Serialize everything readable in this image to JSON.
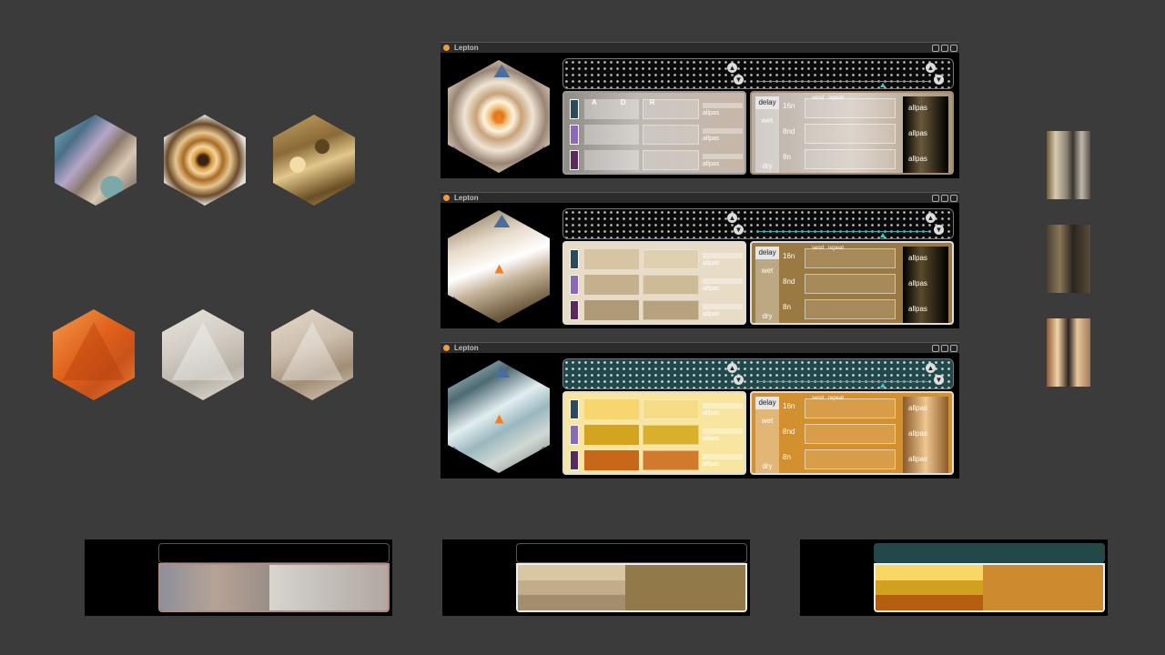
{
  "windows": [
    {
      "title": "Lepton",
      "variant": "v1",
      "teal": false
    },
    {
      "title": "Lepton",
      "variant": "v2",
      "teal": false
    },
    {
      "title": "Lepton",
      "variant": "v3",
      "teal": true
    }
  ],
  "synth": {
    "adr_label": "A D R",
    "filter_option": "allpas"
  },
  "fx": {
    "delay_label": "delay",
    "wet_label": "wet",
    "dry_label": "dry",
    "notes": [
      "16n",
      "8nd",
      "8n"
    ],
    "send_label": "send",
    "repeat_label": "repeat",
    "filter_option": "allpas"
  },
  "colors": {
    "background": "#3b3b3b",
    "accent_orange": "#f39a3a",
    "teal": "#23484a"
  }
}
